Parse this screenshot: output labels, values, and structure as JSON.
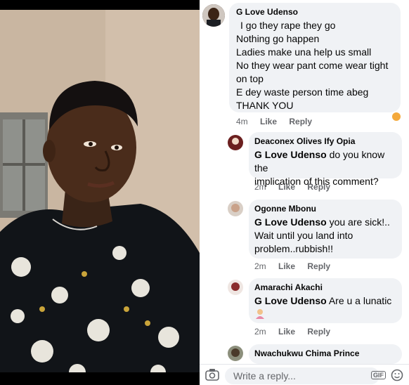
{
  "comments": [
    {
      "author": "G Love Udenso",
      "lines": [
        "I go they rape they go",
        "Nothing go happen",
        "Ladies make una help us  small",
        "No they wear pant come wear tight",
        "on top",
        "E dey waste person time abeg",
        "THANK YOU"
      ],
      "time": "4m",
      "like": "Like",
      "reply": "Reply"
    },
    {
      "author": "Deaconex Olives Ify Opia",
      "mention": "G Love Udenso",
      "line1": "do you know the",
      "line2": "implication of this comment?",
      "time": "2m",
      "like": "Like",
      "reply": "Reply"
    },
    {
      "author": "Ogonne Mbonu",
      "mention": "G Love Udenso",
      "line1": "you are sick!..",
      "line2": "Wait until you land into",
      "line3": "problem..rubbish!!",
      "time": "2m",
      "like": "Like",
      "reply": "Reply"
    },
    {
      "author": "Amarachi Akachi",
      "mention": "G Love Udenso",
      "line1": "Are u a lunatic",
      "time": "2m",
      "like": "Like",
      "reply": "Reply"
    },
    {
      "author": "Nwachukwu Chima Prince"
    }
  ],
  "reply_box": {
    "placeholder": "Write a reply...",
    "gif_label": "GIF"
  },
  "icons": {
    "camera": "camera-icon",
    "gif": "gif-icon",
    "emoji": "emoji-icon",
    "reaction": "angry-reaction-icon"
  },
  "colors": {
    "bubble": "#f0f2f5",
    "meta_text": "#65676b",
    "reaction": "#f4a93b"
  }
}
